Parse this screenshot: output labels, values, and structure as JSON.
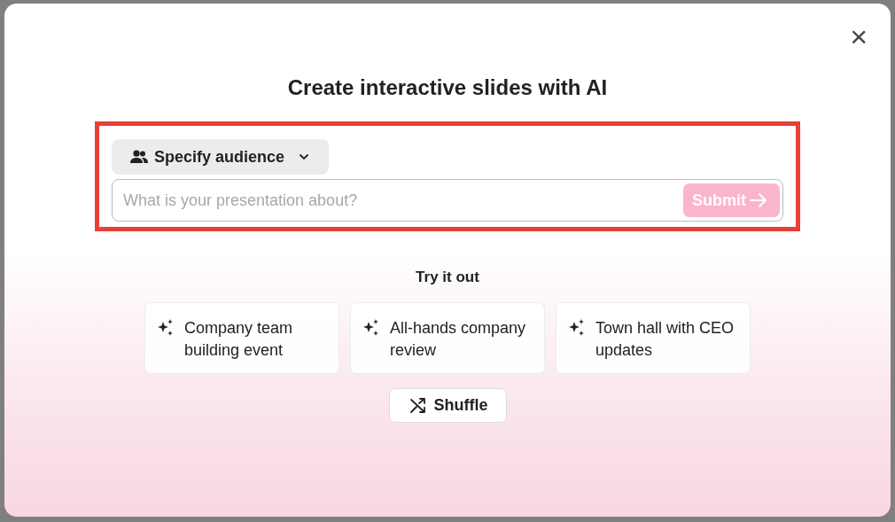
{
  "dialog": {
    "title": "Create interactive slides with AI",
    "close": "×"
  },
  "prompt_area": {
    "highlighted": true,
    "audience_button": {
      "label": "Specify audience"
    },
    "input": {
      "placeholder": "What is your presentation about?"
    },
    "submit": {
      "label": "Submit",
      "disabled": true
    }
  },
  "suggestions": {
    "heading": "Try it out",
    "items": [
      {
        "label": "Company team building event"
      },
      {
        "label": "All-hands company review"
      },
      {
        "label": "Town hall with CEO updates"
      }
    ],
    "shuffle": {
      "label": "Shuffle"
    }
  }
}
